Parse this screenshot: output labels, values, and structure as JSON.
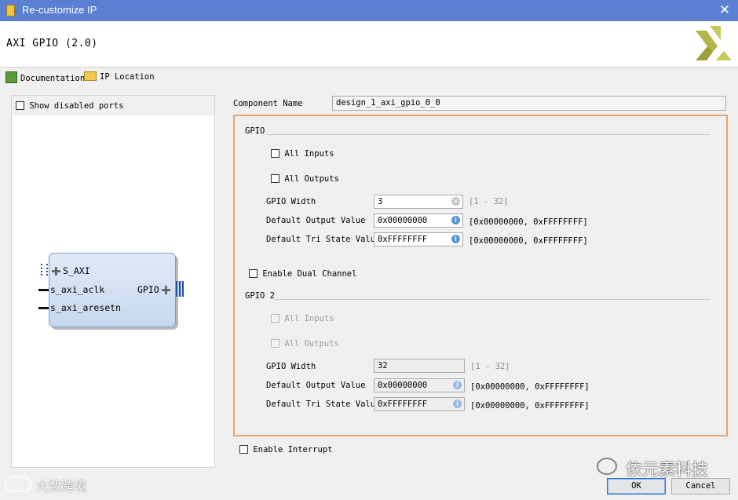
{
  "window": {
    "title": "Re-customize IP",
    "close_icon": "close-icon"
  },
  "header": {
    "ip_title": "AXI GPIO (2.0)",
    "logo": "xilinx-logo"
  },
  "links": {
    "documentation": "Documentation",
    "ip_location": "IP Location"
  },
  "left_panel": {
    "show_disabled_ports": "Show disabled ports",
    "block": {
      "bus_port": "S_AXI",
      "clk_port": "s_axi_aclk",
      "reset_port": "s_axi_aresetn",
      "gpio_port": "GPIO"
    }
  },
  "component_name": {
    "label": "Component Name",
    "value": "design_1_axi_gpio_0_0"
  },
  "gpio": {
    "section_title": "GPIO",
    "all_inputs": "All Inputs",
    "all_outputs": "All Outputs",
    "width": {
      "label": "GPIO Width",
      "value": "3",
      "range": "[1 - 32]"
    },
    "default_output": {
      "label": "Default Output Value",
      "value": "0x00000000",
      "range": "[0x00000000, 0xFFFFFFFF]"
    },
    "default_tri": {
      "label": "Default Tri State Value",
      "value": "0xFFFFFFFF",
      "range": "[0x00000000, 0xFFFFFFFF]"
    }
  },
  "enable_dual_channel": "Enable Dual Channel",
  "gpio2": {
    "section_title": "GPIO 2",
    "all_inputs": "All Inputs",
    "all_outputs": "All Outputs",
    "width": {
      "label": "GPIO Width",
      "value": "32",
      "range": "[1 - 32]"
    },
    "default_output": {
      "label": "Default Output Value",
      "value": "0x00000000",
      "range": "[0x00000000, 0xFFFFFFFF]"
    },
    "default_tri": {
      "label": "Default Tri State Value",
      "value": "0xFFFFFFFF",
      "range": "[0x00000000, 0xFFFFFFFF]"
    }
  },
  "enable_interrupt": "Enable Interrupt",
  "buttons": {
    "ok": "OK",
    "cancel": "Cancel"
  },
  "watermarks": {
    "left": "大数跨境",
    "right": "依元素科技"
  },
  "colors": {
    "titlebar": "#5b7fd1",
    "group_border": "#e9a36a",
    "block_fill": "#c6d8ee",
    "info": "#5a93d8"
  }
}
